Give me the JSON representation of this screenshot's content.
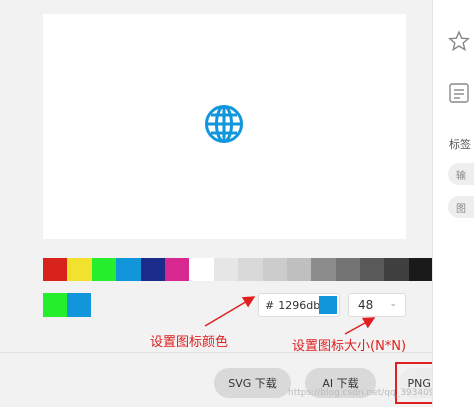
{
  "palette": [
    "#d8231b",
    "#f2e22e",
    "#25ee2c",
    "#1296db",
    "#1a2b8c",
    "#d6288f",
    "#ffffff",
    "#e6e6e6",
    "#d9d9d9",
    "#cccccc",
    "#bfbfbf",
    "#8c8c8c",
    "#737373",
    "#595959",
    "#404040",
    "#1a1a1a"
  ],
  "recent_colors": [
    "#25ee2c",
    "#1296db"
  ],
  "icon": {
    "name": "globe-icon",
    "color": "#1296db"
  },
  "color_input": {
    "hash": "#",
    "value": "1296db",
    "chip": "#1296db"
  },
  "size_select": {
    "value": "48"
  },
  "annotations": {
    "color_note": "设置图标颜色",
    "size_note": "设置图标大小(N*N)"
  },
  "buttons": {
    "svg": "SVG 下载",
    "ai": "AI 下载",
    "png": "PNG 下载"
  },
  "watermark": "https://blog.csdn.net/qq_39340900",
  "right_rail": {
    "section_label": "标签",
    "chip1": "输",
    "chip2": "图"
  }
}
